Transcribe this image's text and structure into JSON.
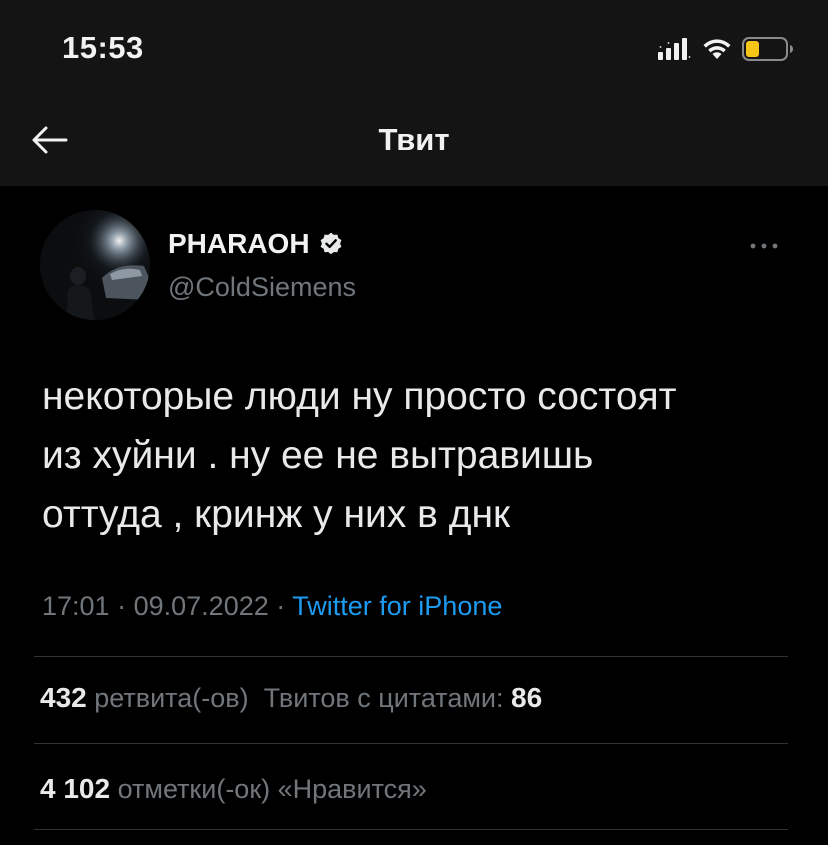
{
  "status_bar": {
    "time": "15:53"
  },
  "header": {
    "title": "Твит"
  },
  "tweet": {
    "author": {
      "name": "PHARAOH",
      "handle": "@ColdSiemens",
      "verified": true
    },
    "text": "некоторые люди ну просто состоят\nиз хуйни . ну ее не вытравишь\nоттуда , кринж у них в днк",
    "time": "17:01",
    "date": "09.07.2022",
    "separator": "·",
    "source": "Twitter for iPhone"
  },
  "stats": {
    "retweets_count": "432",
    "retweets_label": "ретвита(-ов)",
    "quotes_label": "Твитов с цитатами:",
    "quotes_count": "86",
    "likes_count": "4 102",
    "likes_label": "отметки(-ок) «Нравится»"
  },
  "colors": {
    "background": "#000000",
    "header_background": "#141414",
    "text_primary": "#e7e9ea",
    "text_secondary": "#71767b",
    "accent": "#1d9bf0",
    "battery_fill": "#f5c518"
  },
  "icons": {
    "back": "arrow-left-icon",
    "verified": "verified-badge-icon",
    "more": "more-dots-icon",
    "signal": "cellular-signal-icon",
    "wifi": "wifi-icon",
    "battery": "battery-icon"
  }
}
